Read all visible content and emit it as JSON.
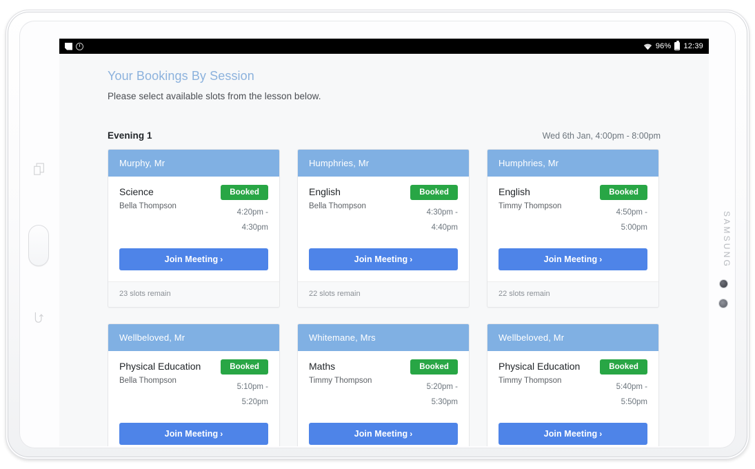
{
  "device": {
    "brand": "SAMSUNG",
    "icons": {
      "recent_apps": "recent-apps-icon",
      "home": "home-button",
      "back": "back-icon",
      "front_camera": "front-camera-icon",
      "light_sensor": "light-sensor-icon"
    }
  },
  "status_bar": {
    "notification_icons": [
      "note-icon",
      "clock-icon"
    ],
    "wifi_icon": "wifi-icon",
    "battery_percent": "96%",
    "battery_icon": "battery-icon",
    "time": "12:39"
  },
  "page": {
    "title": "Your Bookings By Session",
    "subtitle": "Please select available slots from the lesson below.",
    "title_color": "#8cb2dd",
    "background_color": "#f7f8f9"
  },
  "session": {
    "name": "Evening 1",
    "datetime": "Wed 6th Jan, 4:00pm - 8:00pm"
  },
  "colors": {
    "card_header": "#80b0e3",
    "badge_booked": "#28a645",
    "join_button": "#4e84e8",
    "footer_background": "#f8f9fa"
  },
  "labels": {
    "join_meeting": "Join Meeting",
    "chevron": "›",
    "badge_booked": "Booked"
  },
  "bookings": [
    {
      "teacher": "Murphy, Mr",
      "subject": "Science",
      "student": "Bella Thompson",
      "status": "Booked",
      "time_start": "4:20pm -",
      "time_end": "4:30pm",
      "action": "Join Meeting",
      "slots_remain": "23 slots remain"
    },
    {
      "teacher": "Humphries, Mr",
      "subject": "English",
      "student": "Bella Thompson",
      "status": "Booked",
      "time_start": "4:30pm -",
      "time_end": "4:40pm",
      "action": "Join Meeting",
      "slots_remain": "22 slots remain"
    },
    {
      "teacher": "Humphries, Mr",
      "subject": "English",
      "student": "Timmy Thompson",
      "status": "Booked",
      "time_start": "4:50pm -",
      "time_end": "5:00pm",
      "action": "Join Meeting",
      "slots_remain": "22 slots remain"
    },
    {
      "teacher": "Wellbeloved, Mr",
      "subject": "Physical Education",
      "student": "Bella Thompson",
      "status": "Booked",
      "time_start": "5:10pm -",
      "time_end": "5:20pm",
      "action": "Join Meeting",
      "slots_remain": ""
    },
    {
      "teacher": "Whitemane, Mrs",
      "subject": "Maths",
      "student": "Timmy Thompson",
      "status": "Booked",
      "time_start": "5:20pm -",
      "time_end": "5:30pm",
      "action": "Join Meeting",
      "slots_remain": ""
    },
    {
      "teacher": "Wellbeloved, Mr",
      "subject": "Physical Education",
      "student": "Timmy Thompson",
      "status": "Booked",
      "time_start": "5:40pm -",
      "time_end": "5:50pm",
      "action": "Join Meeting",
      "slots_remain": ""
    }
  ]
}
